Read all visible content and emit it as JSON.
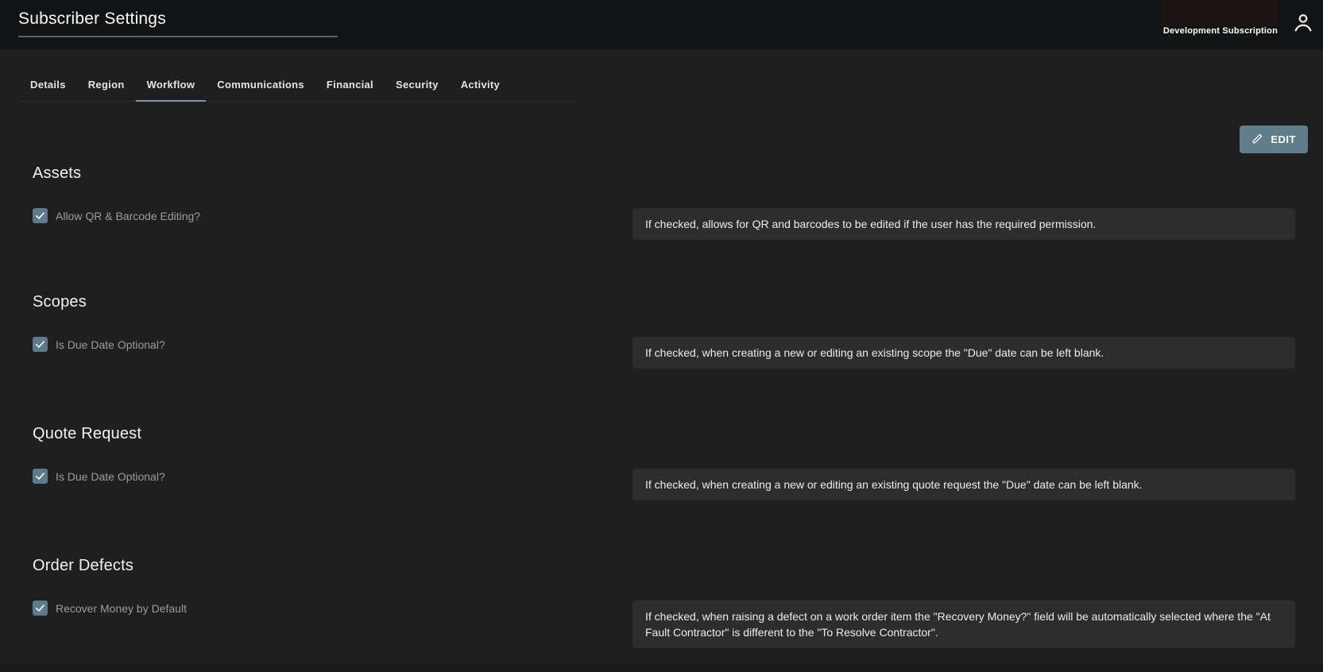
{
  "header": {
    "title": "Subscriber Settings",
    "subscription_label": "Development Subscription"
  },
  "tabs": [
    {
      "label": "Details",
      "active": false
    },
    {
      "label": "Region",
      "active": false
    },
    {
      "label": "Workflow",
      "active": true
    },
    {
      "label": "Communications",
      "active": false
    },
    {
      "label": "Financial",
      "active": false
    },
    {
      "label": "Security",
      "active": false
    },
    {
      "label": "Activity",
      "active": false
    }
  ],
  "toolbar": {
    "edit_label": "EDIT"
  },
  "sections": [
    {
      "title": "Assets",
      "settings": [
        {
          "label": "Allow QR & Barcode Editing?",
          "checked": true,
          "description": "If checked, allows for QR and barcodes to be edited if the user has the required permission."
        }
      ]
    },
    {
      "title": "Scopes",
      "settings": [
        {
          "label": "Is Due Date Optional?",
          "checked": true,
          "description": "If checked, when creating a new or editing an existing scope the \"Due\" date can be left blank."
        }
      ]
    },
    {
      "title": "Quote Request",
      "settings": [
        {
          "label": "Is Due Date Optional?",
          "checked": true,
          "description": "If checked, when creating a new or editing an existing quote request the \"Due\" date can be left blank."
        }
      ]
    },
    {
      "title": "Order Defects",
      "settings": [
        {
          "label": "Recover Money by Default",
          "checked": true,
          "description": "If checked, when raising a defect on a work order item the \"Recovery Money?\" field will be automatically selected where the \"At Fault Contractor\" is different to the \"To Resolve Contractor\"."
        }
      ]
    }
  ],
  "colors": {
    "topbar_bg": "#121314",
    "content_bg": "#1f1f1f",
    "panel_bg": "#2d2d2d",
    "accent": "#607d8c",
    "active_tab_underline": "#7e98a5",
    "title_underline": "#51646e"
  }
}
